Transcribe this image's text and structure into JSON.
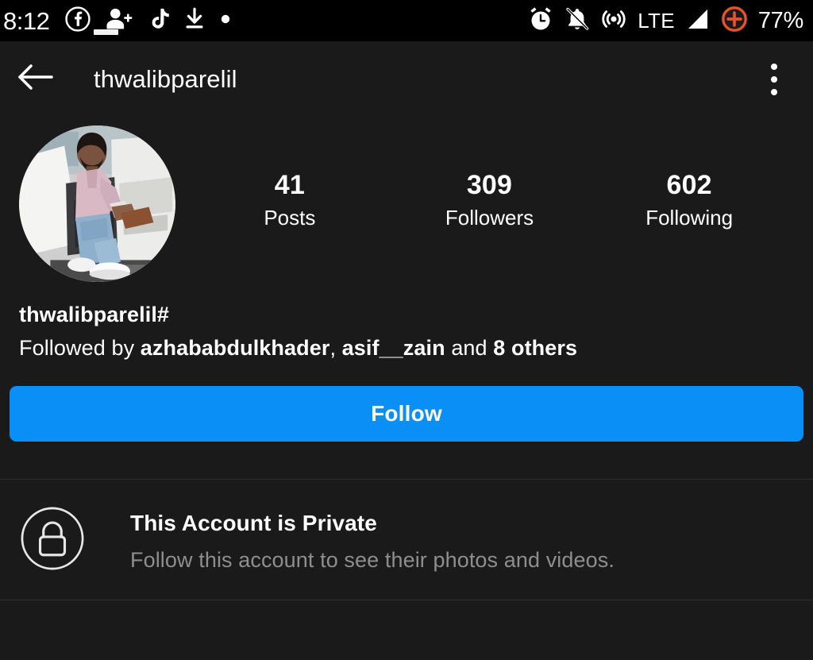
{
  "status_bar": {
    "time": "8:12",
    "battery_percent": "77%",
    "network_type": "LTE",
    "background_color": "#000000",
    "left_icons": [
      {
        "name": "facebook-icon",
        "label": "Facebook"
      },
      {
        "name": "person-add-icon",
        "label": "Friend request"
      },
      {
        "name": "tiktok-icon",
        "label": "TikTok"
      },
      {
        "name": "download-icon",
        "label": "Download"
      },
      {
        "name": "dot-icon",
        "label": "More notifications"
      }
    ],
    "right_icons": [
      {
        "name": "alarm-clock-icon",
        "label": "Alarm set"
      },
      {
        "name": "bell-muted-icon",
        "label": "Notifications silenced"
      },
      {
        "name": "hotspot-icon",
        "label": "Hotspot"
      },
      {
        "name": "signal-bars-icon",
        "label": "Signal strength"
      },
      {
        "name": "do-not-disturb-icon",
        "label": "Do not disturb"
      }
    ]
  },
  "header": {
    "title": "thwalibparelil",
    "back_icon": "back-arrow-icon",
    "overflow_icon": "overflow-menu-icon"
  },
  "profile": {
    "avatar_alt": "Profile photo: man with beard in pink shirt and blue jeans sitting in open car door",
    "stats": [
      {
        "value": "41",
        "label": "Posts"
      },
      {
        "value": "309",
        "label": "Followers"
      },
      {
        "value": "602",
        "label": "Following"
      }
    ],
    "bio_name": "thwalibparelil#",
    "followed_by": {
      "prefix": "Followed by ",
      "user1": "azhababdulkhader",
      "separator": ", ",
      "user2": "asif__zain",
      "conjunction": " and ",
      "others": "8 others"
    }
  },
  "actions": {
    "follow_label": "Follow",
    "follow_color": "#0a8ff6"
  },
  "private_notice": {
    "lock_icon": "lock-icon",
    "title": "This Account is Private",
    "subtitle": "Follow this account to see their photos and videos."
  },
  "theme": {
    "background": "#1a1a1a",
    "text_primary": "#ffffff",
    "text_secondary": "#8e8e8e",
    "divider": "#2e2e2e"
  }
}
